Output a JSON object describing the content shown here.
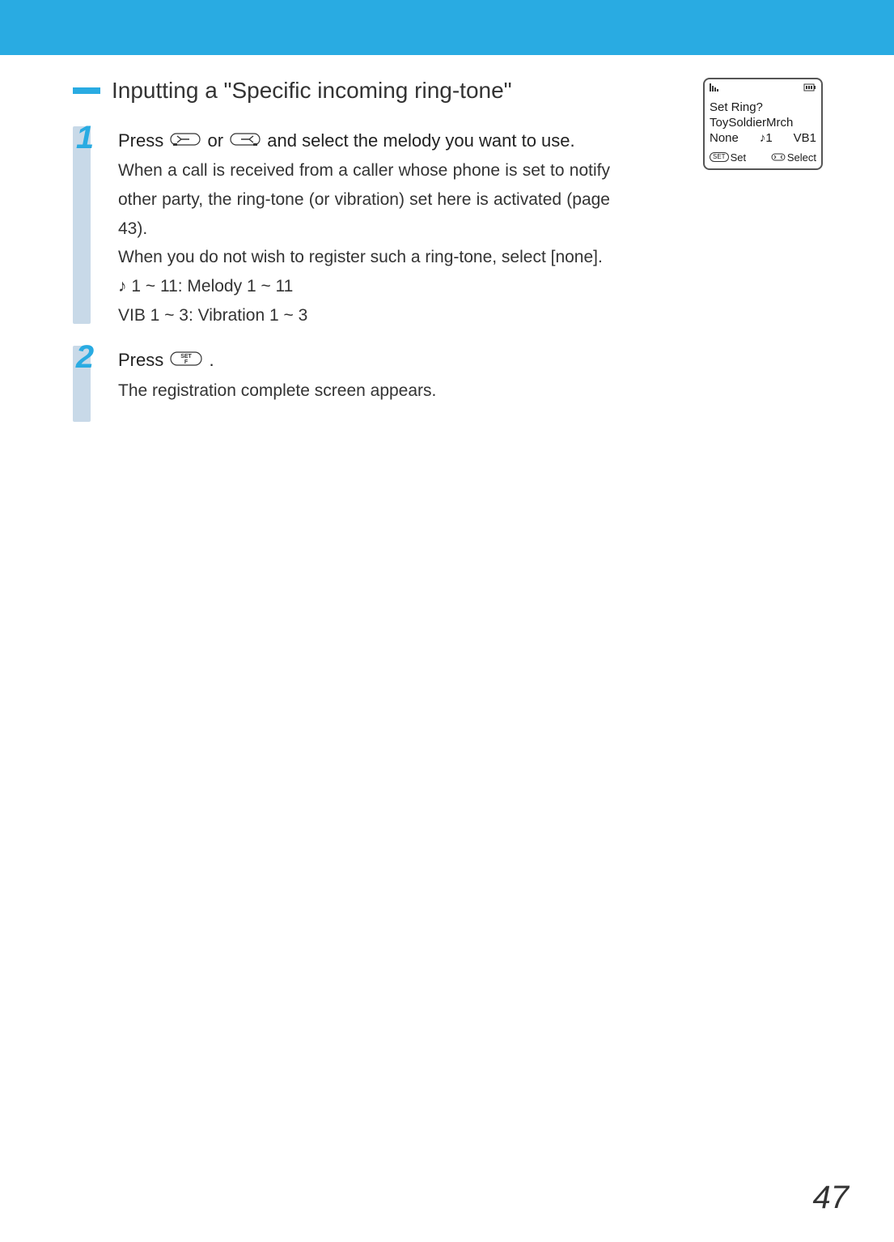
{
  "header": {
    "title": "Inputting a \"Specific incoming ring-tone\""
  },
  "steps": [
    {
      "number": "1",
      "lead_a": "Press ",
      "lead_b": " or ",
      "lead_c": " and select the melody you want to use.",
      "body_1": "When a call is received from a caller whose phone is set to notify other party, the ring-tone (or vibration) set here is activated (page 43).",
      "body_2": "When you do not wish to register such a ring-tone, select [none].",
      "melody_line": " 1 ~ 11: Melody 1 ~ 11",
      "vib_line": "VIB 1 ~ 3: Vibration 1 ~ 3"
    },
    {
      "number": "2",
      "lead_a": " Press ",
      "lead_b": ".",
      "body_1": "The registration complete screen appears."
    }
  ],
  "phone": {
    "title": "Set Ring?",
    "line2": "ToySoldierMrch",
    "opt_none": "None",
    "opt_m1": "1",
    "opt_vb1": "VB1",
    "soft_left_badge": "SET",
    "soft_left": "Set",
    "soft_right": "Select"
  },
  "page_number": "47"
}
